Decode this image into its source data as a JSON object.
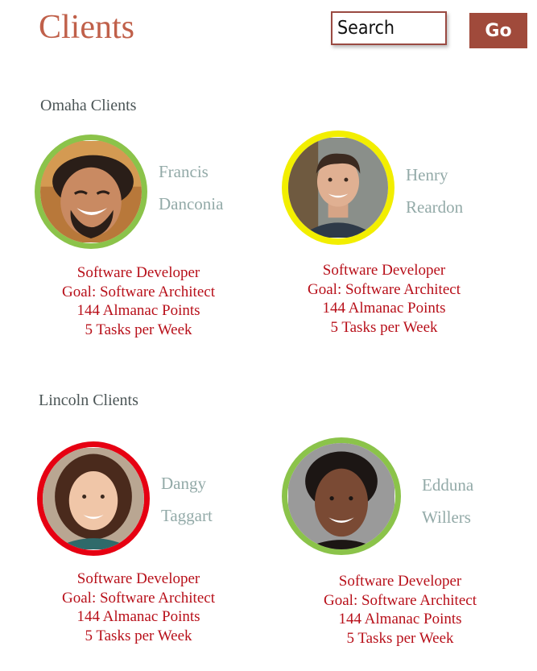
{
  "page": {
    "title": "Clients"
  },
  "search": {
    "placeholder": "Search",
    "button_label": "Go"
  },
  "colors": {
    "accent": "#a04a3b",
    "title": "#c0604a",
    "name": "#93aaa8",
    "details": "#b8101a",
    "ring_green": "#8bc34a",
    "ring_yellow": "#f2ee00",
    "ring_red": "#e60012"
  },
  "groups": [
    {
      "title": "Omaha Clients",
      "clients": [
        {
          "first_name": "Francis",
          "last_name": "Danconia",
          "ring": "green",
          "role": "Software Developer",
          "goal": "Goal: Software Architect",
          "points": "144 Almanac Points",
          "tasks": "5 Tasks per Week"
        },
        {
          "first_name": "Henry",
          "last_name": "Reardon",
          "ring": "yellow",
          "role": "Software Developer",
          "goal": "Goal: Software Architect",
          "points": "144 Almanac Points",
          "tasks": "5 Tasks per Week"
        }
      ]
    },
    {
      "title": "Lincoln Clients",
      "clients": [
        {
          "first_name": "Dangy",
          "last_name": "Taggart",
          "ring": "red",
          "role": "Software Developer",
          "goal": "Goal: Software Architect",
          "points": "144 Almanac Points",
          "tasks": "5 Tasks per Week"
        },
        {
          "first_name": "Edduna",
          "last_name": "Willers",
          "ring": "green",
          "role": "Software Developer",
          "goal": "Goal: Software Architect",
          "points": "144 Almanac Points",
          "tasks": "5 Tasks per Week"
        }
      ]
    }
  ]
}
